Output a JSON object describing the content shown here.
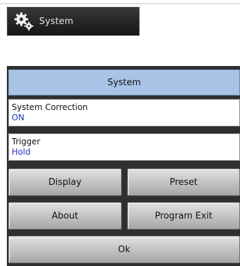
{
  "tab": {
    "label": "System"
  },
  "panel": {
    "title": "System",
    "rows": [
      {
        "label": "System Correction",
        "value": "ON"
      },
      {
        "label": "Trigger",
        "value": "Hold"
      }
    ],
    "buttons": {
      "display": "Display",
      "preset": "Preset",
      "about": "About",
      "program_exit": "Program Exit",
      "ok": "Ok"
    }
  },
  "colors": {
    "header_bg": "#a9c3e6",
    "value_text": "#1a38d8",
    "tab_bg": "#1e1e1e"
  },
  "icons": {
    "tab_icon": "gears-icon"
  }
}
